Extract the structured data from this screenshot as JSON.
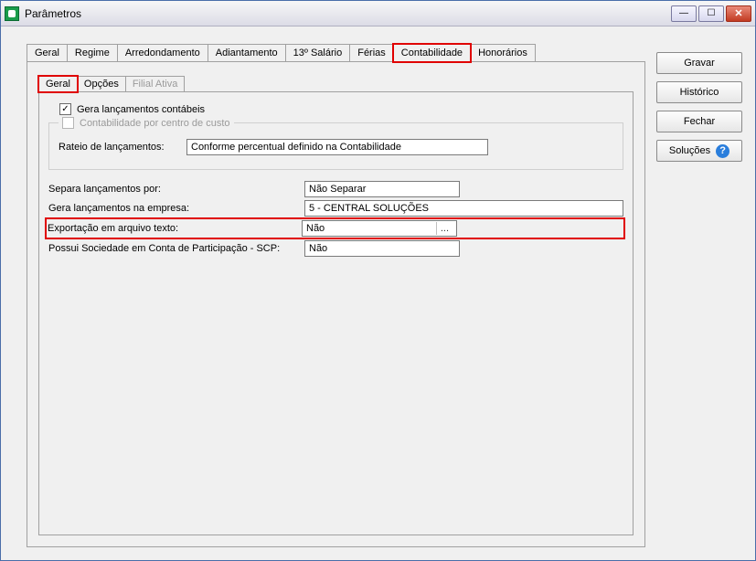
{
  "window": {
    "title": "Parâmetros"
  },
  "outer_tabs": {
    "items": [
      {
        "label": "Geral"
      },
      {
        "label": "Regime"
      },
      {
        "label": "Arredondamento"
      },
      {
        "label": "Adiantamento"
      },
      {
        "label": "13º Salário"
      },
      {
        "label": "Férias"
      },
      {
        "label": "Contabilidade"
      },
      {
        "label": "Honorários"
      }
    ],
    "highlighted": "Contabilidade"
  },
  "inner_tabs": {
    "items": [
      {
        "label": "Geral",
        "state": "active"
      },
      {
        "label": "Opções",
        "state": "normal"
      },
      {
        "label": "Filial Ativa",
        "state": "disabled"
      }
    ],
    "highlighted": "Geral"
  },
  "content": {
    "gera_lancamentos_label": "Gera lançamentos contábeis",
    "gera_lancamentos_checked": true,
    "group_title": "Contabilidade por centro de custo",
    "group_checked": false,
    "rateio_label": "Rateio de lançamentos:",
    "rateio_value": "Conforme percentual definido na Contabilidade",
    "fields": {
      "separa": {
        "label": "Separa lançamentos por:",
        "value": "Não Separar"
      },
      "gera_empresa": {
        "label": "Gera lançamentos na empresa:",
        "value": "5 - CENTRAL SOLUÇÕES"
      },
      "export": {
        "label": "Exportação em arquivo texto:",
        "value": "Não",
        "has_button": true
      },
      "scp": {
        "label": "Possui Sociedade em Conta de Participação - SCP:",
        "value": "Não"
      }
    },
    "highlighted_row": "export"
  },
  "side": {
    "gravar": "Gravar",
    "historico": "Histórico",
    "fechar": "Fechar",
    "solucoes": "Soluções"
  },
  "glyphs": {
    "minimize": "—",
    "maximize": "☐",
    "close": "✕"
  }
}
